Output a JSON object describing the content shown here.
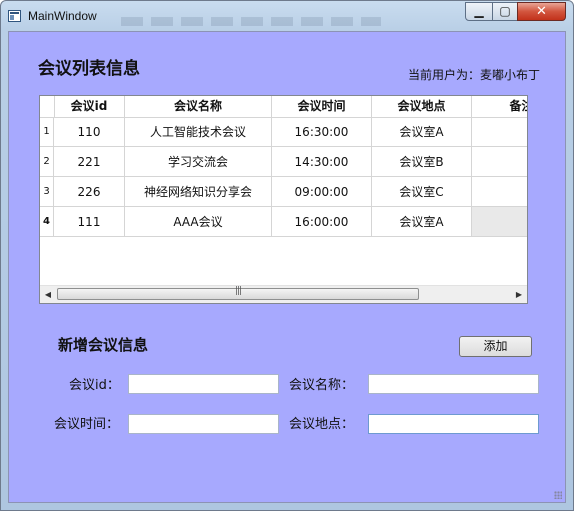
{
  "window": {
    "title": "MainWindow"
  },
  "titlebar_buttons": {
    "minimize": "▁",
    "maximize": "▢",
    "close": "✕"
  },
  "list_section": {
    "heading": "会议列表信息",
    "user_label": "当前用户为：麦嘟小布丁"
  },
  "table": {
    "columns": [
      "会议id",
      "会议名称",
      "会议时间",
      "会议地点",
      "备注"
    ],
    "rows": [
      {
        "num": "1",
        "cells": [
          "110",
          "人工智能技术会议",
          "16:30:00",
          "会议室A",
          ""
        ]
      },
      {
        "num": "2",
        "cells": [
          "221",
          "学习交流会",
          "14:30:00",
          "会议室B",
          ""
        ]
      },
      {
        "num": "3",
        "cells": [
          "226",
          "神经网络知识分享会",
          "09:00:00",
          "会议室C",
          ""
        ]
      },
      {
        "num": "4",
        "cells": [
          "111",
          "AAA会议",
          "16:00:00",
          "会议室A",
          ""
        ]
      }
    ],
    "scroll_left": "◀",
    "scroll_right": "▶",
    "scroll_thumb_grip": "|||"
  },
  "new_section": {
    "heading": "新增会议信息",
    "add_button": "添加",
    "fields": {
      "id_label": "会议id：",
      "name_label": "会议名称：",
      "time_label": "会议时间：",
      "place_label": "会议地点："
    }
  }
}
